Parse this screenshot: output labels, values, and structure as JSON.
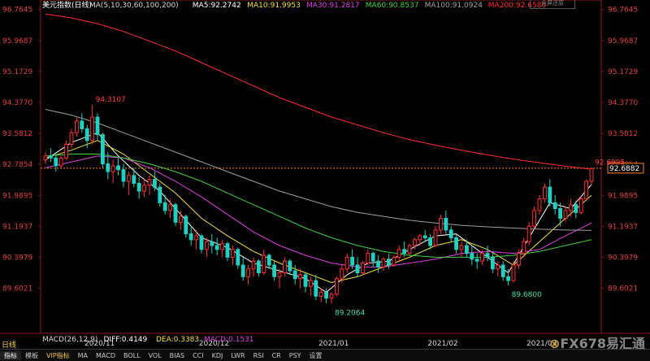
{
  "chart_data": {
    "type": "candlestick",
    "title": "美元指数(日线)",
    "ma_legend": [
      {
        "label": "MA(5,10,30,60,100,200)",
        "color": "#d8d8d8"
      },
      {
        "label": "MA5:92.2742",
        "color": "#ffffff"
      },
      {
        "label": "MA10:91.9953",
        "color": "#f0e040"
      },
      {
        "label": "MA30:91.2817",
        "color": "#e040e0"
      },
      {
        "label": "MA60:90.8537",
        "color": "#40d040"
      },
      {
        "label": "MA100:91.0924",
        "color": "#a0a0a0"
      },
      {
        "label": "MA200:92.6580",
        "color": "#ff3030"
      }
    ],
    "y_ticks": [
      "96.7645",
      "95.9687",
      "95.1729",
      "94.3770",
      "93.5812",
      "92.7854",
      "91.9895",
      "91.1937",
      "90.3979",
      "89.6021"
    ],
    "ylim": [
      89.28,
      96.8
    ],
    "x_ticks": [
      {
        "label": "2020/11",
        "idx": 10
      },
      {
        "label": "2020/12",
        "idx": 32
      },
      {
        "label": "2021/01",
        "idx": 55
      },
      {
        "label": "2021/02",
        "idx": 76
      },
      {
        "label": "2021/03",
        "idx": 95
      }
    ],
    "price_annotations": [
      {
        "label": "94.3107",
        "value": 94.3107,
        "idx": 9,
        "color": "#ff4040"
      },
      {
        "label": "89.2064",
        "value": 89.2064,
        "idx": 55,
        "color": "#40e0a0"
      },
      {
        "label": "89.6800",
        "value": 89.68,
        "idx": 89,
        "color": "#40e0a0"
      },
      {
        "label": "92.6995",
        "value": 92.6995,
        "idx": 105,
        "color": "#ff4040"
      }
    ],
    "current_price": "92.6882",
    "current_value": 92.6882,
    "candles": [
      [
        92.9,
        93.1,
        92.8,
        93.0
      ],
      [
        93.0,
        93.2,
        92.85,
        92.95
      ],
      [
        92.95,
        93.05,
        92.6,
        92.75
      ],
      [
        92.75,
        93.0,
        92.7,
        92.95
      ],
      [
        92.95,
        93.4,
        92.9,
        93.3
      ],
      [
        93.3,
        93.7,
        93.2,
        93.6
      ],
      [
        93.6,
        94.0,
        93.5,
        93.9
      ],
      [
        93.9,
        94.1,
        93.6,
        93.7
      ],
      [
        93.7,
        93.8,
        93.2,
        93.4
      ],
      [
        93.4,
        94.31,
        93.3,
        94.0
      ],
      [
        94.0,
        94.1,
        93.4,
        93.55
      ],
      [
        93.55,
        93.6,
        92.7,
        92.8
      ],
      [
        92.8,
        93.1,
        92.4,
        92.6
      ],
      [
        92.6,
        92.9,
        92.3,
        92.75
      ],
      [
        92.75,
        92.95,
        92.5,
        92.65
      ],
      [
        92.65,
        92.8,
        92.2,
        92.35
      ],
      [
        92.35,
        92.6,
        92.0,
        92.5
      ],
      [
        92.5,
        92.7,
        92.2,
        92.3
      ],
      [
        92.3,
        92.45,
        91.9,
        92.1
      ],
      [
        92.1,
        92.4,
        91.95,
        92.25
      ],
      [
        92.25,
        92.5,
        92.0,
        92.4
      ],
      [
        92.4,
        92.6,
        92.1,
        92.2
      ],
      [
        92.2,
        92.3,
        91.7,
        91.8
      ],
      [
        91.8,
        92.0,
        91.5,
        91.6
      ],
      [
        91.6,
        91.9,
        91.4,
        91.75
      ],
      [
        91.75,
        91.8,
        91.2,
        91.3
      ],
      [
        91.3,
        91.6,
        91.1,
        91.45
      ],
      [
        91.45,
        91.5,
        90.9,
        91.0
      ],
      [
        91.0,
        91.2,
        90.7,
        90.85
      ],
      [
        90.85,
        91.1,
        90.6,
        90.95
      ],
      [
        90.95,
        91.0,
        90.5,
        90.6
      ],
      [
        90.6,
        90.9,
        90.4,
        90.8
      ],
      [
        90.8,
        91.0,
        90.5,
        90.7
      ],
      [
        90.7,
        90.9,
        90.45,
        90.6
      ],
      [
        90.6,
        90.85,
        90.4,
        90.75
      ],
      [
        90.75,
        90.8,
        90.3,
        90.4
      ],
      [
        90.4,
        90.7,
        90.2,
        90.6
      ],
      [
        90.6,
        90.65,
        90.1,
        90.2
      ],
      [
        90.2,
        90.4,
        89.8,
        89.9
      ],
      [
        89.9,
        90.2,
        89.7,
        90.1
      ],
      [
        90.1,
        90.4,
        89.9,
        90.3
      ],
      [
        90.3,
        90.35,
        89.9,
        90.0
      ],
      [
        90.0,
        90.6,
        89.95,
        90.45
      ],
      [
        90.45,
        90.5,
        90.1,
        90.2
      ],
      [
        90.2,
        90.3,
        89.8,
        89.9
      ],
      [
        89.9,
        90.1,
        89.6,
        90.0
      ],
      [
        90.0,
        90.4,
        89.9,
        90.3
      ],
      [
        90.3,
        90.35,
        89.95,
        90.05
      ],
      [
        90.05,
        90.2,
        89.7,
        89.85
      ],
      [
        89.85,
        90.1,
        89.6,
        89.95
      ],
      [
        89.95,
        90.0,
        89.5,
        89.65
      ],
      [
        89.65,
        89.9,
        89.4,
        89.8
      ],
      [
        89.8,
        89.95,
        89.3,
        89.4
      ],
      [
        89.4,
        89.6,
        89.25,
        89.5
      ],
      [
        89.5,
        89.6,
        89.22,
        89.35
      ],
      [
        89.35,
        89.5,
        89.21,
        89.45
      ],
      [
        89.45,
        89.9,
        89.4,
        89.85
      ],
      [
        89.85,
        90.2,
        89.75,
        90.1
      ],
      [
        90.1,
        90.5,
        90.0,
        90.4
      ],
      [
        90.4,
        90.6,
        90.1,
        90.2
      ],
      [
        90.2,
        90.4,
        89.9,
        90.0
      ],
      [
        90.0,
        90.3,
        89.95,
        90.25
      ],
      [
        90.25,
        90.6,
        90.2,
        90.5
      ],
      [
        90.5,
        90.55,
        90.15,
        90.3
      ],
      [
        90.3,
        90.45,
        90.0,
        90.15
      ],
      [
        90.15,
        90.4,
        90.05,
        90.35
      ],
      [
        90.35,
        90.5,
        90.1,
        90.2
      ],
      [
        90.2,
        90.45,
        90.15,
        90.4
      ],
      [
        90.4,
        90.7,
        90.3,
        90.6
      ],
      [
        90.6,
        90.8,
        90.4,
        90.5
      ],
      [
        90.5,
        90.75,
        90.45,
        90.7
      ],
      [
        90.7,
        90.9,
        90.6,
        90.85
      ],
      [
        90.85,
        91.0,
        90.7,
        90.95
      ],
      [
        90.95,
        91.1,
        90.8,
        90.9
      ],
      [
        90.9,
        91.0,
        90.6,
        90.7
      ],
      [
        90.7,
        91.2,
        90.65,
        91.1
      ],
      [
        91.1,
        91.5,
        91.0,
        91.4
      ],
      [
        91.4,
        91.6,
        91.0,
        91.1
      ],
      [
        91.1,
        91.2,
        90.8,
        90.9
      ],
      [
        90.9,
        91.0,
        90.5,
        90.6
      ],
      [
        90.6,
        90.8,
        90.4,
        90.7
      ],
      [
        90.7,
        90.85,
        90.4,
        90.5
      ],
      [
        90.5,
        90.7,
        90.2,
        90.35
      ],
      [
        90.35,
        90.5,
        90.1,
        90.3
      ],
      [
        90.3,
        90.6,
        90.2,
        90.5
      ],
      [
        90.5,
        90.7,
        90.3,
        90.4
      ],
      [
        90.4,
        90.55,
        90.0,
        90.1
      ],
      [
        90.1,
        90.3,
        89.9,
        90.2
      ],
      [
        90.2,
        90.3,
        89.8,
        89.9
      ],
      [
        89.9,
        90.1,
        89.68,
        89.8
      ],
      [
        89.8,
        90.3,
        89.75,
        90.2
      ],
      [
        90.2,
        90.6,
        90.1,
        90.5
      ],
      [
        90.5,
        90.9,
        90.4,
        90.8
      ],
      [
        90.8,
        91.3,
        90.7,
        91.2
      ],
      [
        91.2,
        91.7,
        91.1,
        91.6
      ],
      [
        91.6,
        92.0,
        91.5,
        91.9
      ],
      [
        91.9,
        92.3,
        91.8,
        92.2
      ],
      [
        92.2,
        92.4,
        91.7,
        91.8
      ],
      [
        91.8,
        92.0,
        91.5,
        91.65
      ],
      [
        91.65,
        91.8,
        91.2,
        91.4
      ],
      [
        91.4,
        91.7,
        91.3,
        91.6
      ],
      [
        91.6,
        91.9,
        91.45,
        91.75
      ],
      [
        91.75,
        91.85,
        91.4,
        91.55
      ],
      [
        91.55,
        91.95,
        91.5,
        91.9
      ],
      [
        91.9,
        92.4,
        91.85,
        92.35
      ],
      [
        92.35,
        92.7,
        92.25,
        92.68
      ]
    ],
    "ma_lines": [
      {
        "name": "MA5",
        "color": "#ffffff",
        "points": [
          [
            0,
            92.9
          ],
          [
            5,
            93.35
          ],
          [
            10,
            93.6
          ],
          [
            14,
            93.0
          ],
          [
            18,
            92.5
          ],
          [
            22,
            92.1
          ],
          [
            26,
            91.5
          ],
          [
            30,
            90.9
          ],
          [
            35,
            90.65
          ],
          [
            40,
            90.25
          ],
          [
            45,
            90.05
          ],
          [
            50,
            89.85
          ],
          [
            54,
            89.5
          ],
          [
            58,
            89.95
          ],
          [
            62,
            90.25
          ],
          [
            66,
            90.3
          ],
          [
            70,
            90.6
          ],
          [
            75,
            90.95
          ],
          [
            79,
            91.0
          ],
          [
            84,
            90.5
          ],
          [
            89,
            90.0
          ],
          [
            93,
            90.9
          ],
          [
            97,
            91.8
          ],
          [
            101,
            91.65
          ],
          [
            105,
            92.27
          ]
        ]
      },
      {
        "name": "MA10",
        "color": "#f0e040",
        "points": [
          [
            0,
            92.95
          ],
          [
            5,
            93.15
          ],
          [
            10,
            93.4
          ],
          [
            15,
            93.05
          ],
          [
            20,
            92.55
          ],
          [
            25,
            92.05
          ],
          [
            30,
            91.4
          ],
          [
            35,
            90.95
          ],
          [
            40,
            90.55
          ],
          [
            45,
            90.25
          ],
          [
            50,
            90.0
          ],
          [
            55,
            89.75
          ],
          [
            60,
            89.9
          ],
          [
            65,
            90.15
          ],
          [
            70,
            90.4
          ],
          [
            75,
            90.7
          ],
          [
            80,
            90.85
          ],
          [
            85,
            90.6
          ],
          [
            90,
            90.2
          ],
          [
            95,
            90.8
          ],
          [
            100,
            91.4
          ],
          [
            105,
            91.99
          ]
        ]
      },
      {
        "name": "MA30",
        "color": "#e040e0",
        "points": [
          [
            0,
            92.7
          ],
          [
            5,
            92.85
          ],
          [
            10,
            93.0
          ],
          [
            15,
            92.95
          ],
          [
            20,
            92.7
          ],
          [
            25,
            92.35
          ],
          [
            30,
            91.95
          ],
          [
            35,
            91.5
          ],
          [
            40,
            91.05
          ],
          [
            45,
            90.7
          ],
          [
            50,
            90.45
          ],
          [
            55,
            90.25
          ],
          [
            60,
            90.15
          ],
          [
            65,
            90.15
          ],
          [
            70,
            90.25
          ],
          [
            75,
            90.35
          ],
          [
            80,
            90.5
          ],
          [
            85,
            90.55
          ],
          [
            90,
            90.5
          ],
          [
            95,
            90.6
          ],
          [
            100,
            90.95
          ],
          [
            105,
            91.28
          ]
        ]
      },
      {
        "name": "MA60",
        "color": "#40d040",
        "points": [
          [
            0,
            93.0
          ],
          [
            5,
            93.05
          ],
          [
            10,
            93.05
          ],
          [
            15,
            92.95
          ],
          [
            20,
            92.8
          ],
          [
            25,
            92.6
          ],
          [
            30,
            92.35
          ],
          [
            35,
            92.05
          ],
          [
            40,
            91.75
          ],
          [
            45,
            91.45
          ],
          [
            50,
            91.15
          ],
          [
            55,
            90.9
          ],
          [
            60,
            90.7
          ],
          [
            65,
            90.55
          ],
          [
            70,
            90.45
          ],
          [
            75,
            90.4
          ],
          [
            80,
            90.4
          ],
          [
            85,
            90.4
          ],
          [
            90,
            90.45
          ],
          [
            95,
            90.55
          ],
          [
            100,
            90.7
          ],
          [
            105,
            90.85
          ]
        ]
      },
      {
        "name": "MA100",
        "color": "#a0a0a0",
        "points": [
          [
            0,
            94.2
          ],
          [
            5,
            94.05
          ],
          [
            10,
            93.85
          ],
          [
            15,
            93.6
          ],
          [
            20,
            93.35
          ],
          [
            25,
            93.1
          ],
          [
            30,
            92.85
          ],
          [
            35,
            92.6
          ],
          [
            40,
            92.35
          ],
          [
            45,
            92.1
          ],
          [
            50,
            91.9
          ],
          [
            55,
            91.7
          ],
          [
            60,
            91.55
          ],
          [
            65,
            91.45
          ],
          [
            70,
            91.35
          ],
          [
            75,
            91.28
          ],
          [
            80,
            91.22
          ],
          [
            85,
            91.18
          ],
          [
            90,
            91.15
          ],
          [
            95,
            91.12
          ],
          [
            100,
            91.1
          ],
          [
            105,
            91.09
          ]
        ]
      },
      {
        "name": "MA200",
        "color": "#ff3030",
        "points": [
          [
            0,
            96.65
          ],
          [
            5,
            96.55
          ],
          [
            10,
            96.4
          ],
          [
            15,
            96.2
          ],
          [
            20,
            95.95
          ],
          [
            25,
            95.7
          ],
          [
            30,
            95.4
          ],
          [
            35,
            95.1
          ],
          [
            40,
            94.8
          ],
          [
            45,
            94.5
          ],
          [
            50,
            94.25
          ],
          [
            55,
            94.0
          ],
          [
            60,
            93.8
          ],
          [
            65,
            93.6
          ],
          [
            70,
            93.42
          ],
          [
            75,
            93.28
          ],
          [
            80,
            93.15
          ],
          [
            85,
            93.03
          ],
          [
            90,
            92.92
          ],
          [
            95,
            92.83
          ],
          [
            100,
            92.74
          ],
          [
            105,
            92.66
          ]
        ]
      }
    ],
    "macd_legend": [
      {
        "label": "MACD(26,12,9)",
        "color": "#d8d8d8"
      },
      {
        "label": "DIFF:0.4149",
        "color": "#ffffff"
      },
      {
        "label": "DEA:0.3383",
        "color": "#f0e040"
      },
      {
        "label": "MACD:0.1531",
        "color": "#e040e0"
      }
    ]
  },
  "ui": {
    "period_button": "日线",
    "restore_button": "全屏还原",
    "logo_text": "FX678易汇通",
    "tabs": [
      "指标",
      "模板",
      "VIP指标",
      "MA",
      "MACD",
      "BOLL",
      "VOL",
      "BIAS",
      "CCI",
      "KDJ",
      "LWR",
      "RSI",
      "CR",
      "PSY",
      "设置"
    ]
  }
}
